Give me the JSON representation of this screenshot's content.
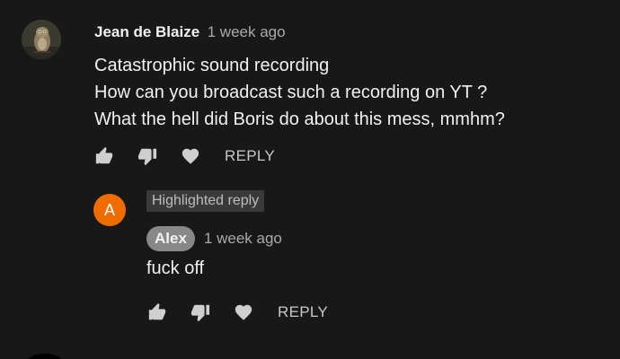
{
  "comment": {
    "author": "Jean de Blaize",
    "timestamp": "1 week ago",
    "lines": [
      "Catastrophic sound recording",
      "How can you broadcast such a recording on YT ?",
      "What the hell did Boris do about this mess, mmhm?"
    ],
    "reply_label": "REPLY"
  },
  "reply": {
    "avatar_letter": "A",
    "highlight_label": "Highlighted reply",
    "author": "Alex",
    "timestamp": "1 week ago",
    "text": "fuck off",
    "reply_label": "REPLY"
  },
  "colors": {
    "background": "#181818",
    "reply_avatar": "#ef6c00"
  }
}
